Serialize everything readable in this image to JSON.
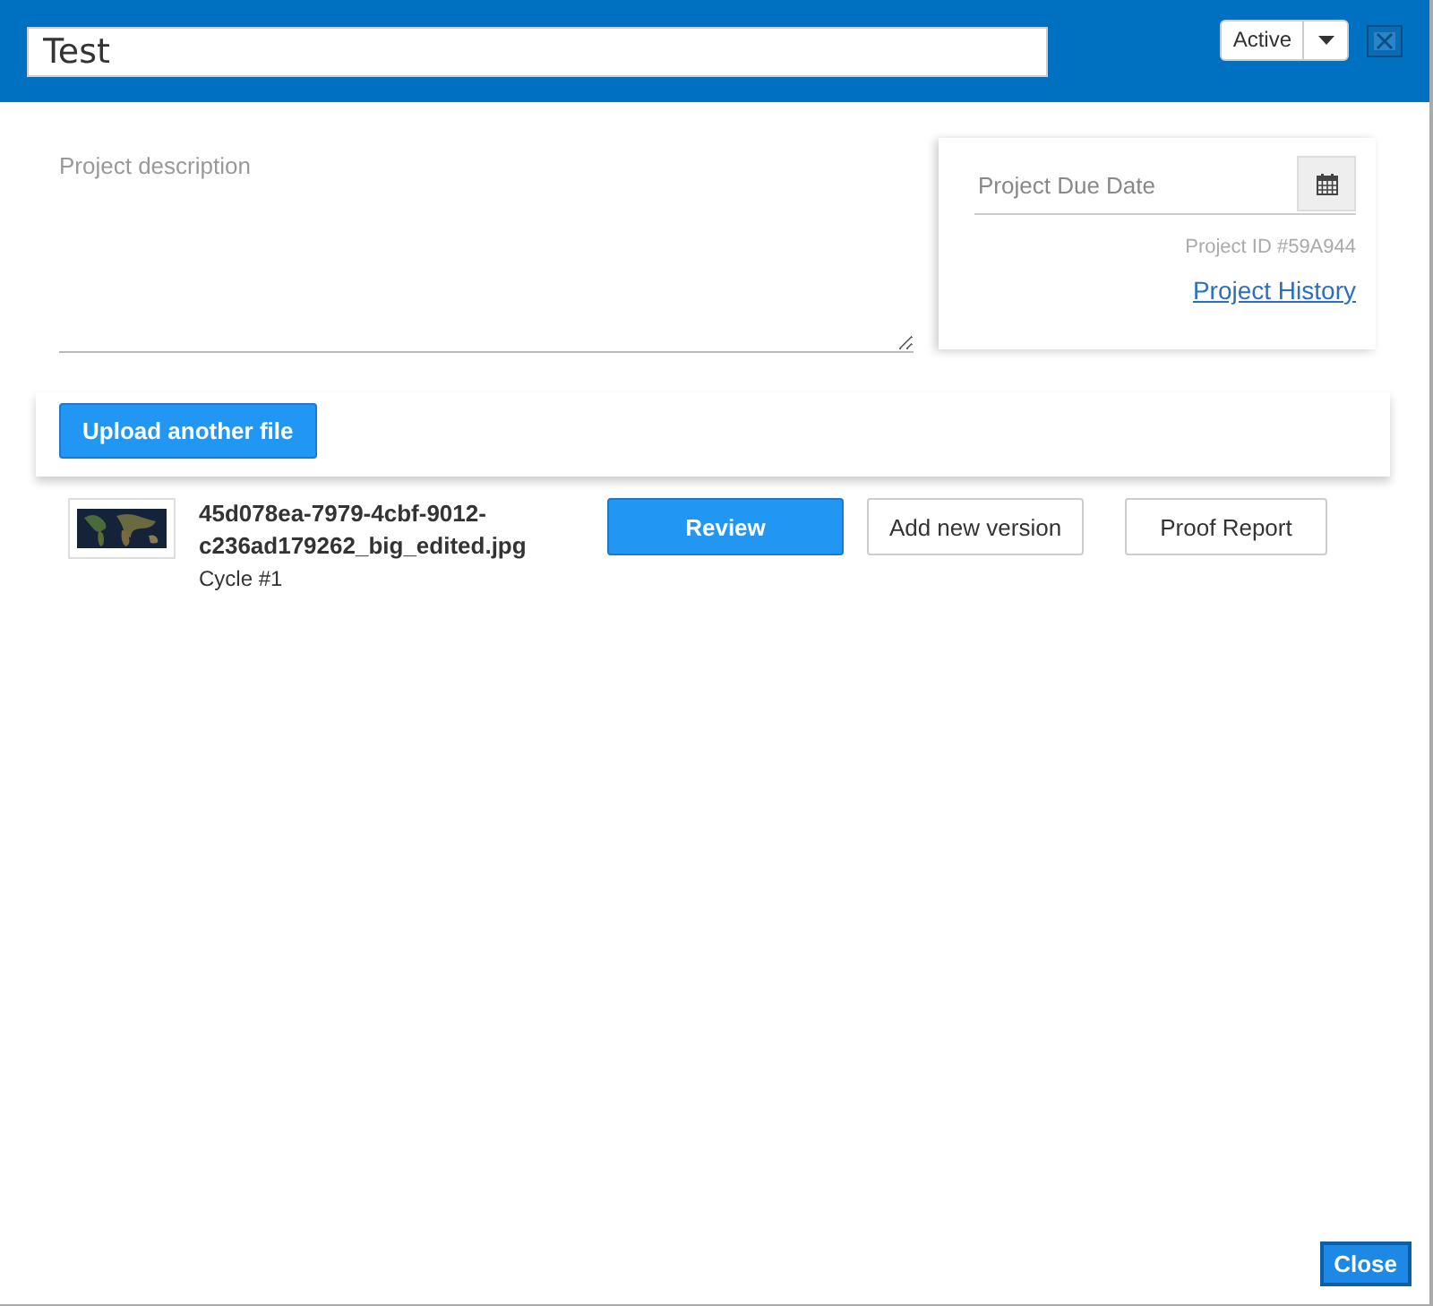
{
  "header": {
    "title": "Test",
    "status": "Active"
  },
  "description": {
    "placeholder": "Project description"
  },
  "details": {
    "due_date_placeholder": "Project Due Date",
    "project_id": "Project ID #59A944",
    "history_link": "Project History"
  },
  "upload_button": "Upload another file",
  "files": [
    {
      "name": "45d078ea-7979-4cbf-9012-c236ad179262_big_edited.jpg",
      "cycle": "Cycle #1",
      "actions": [
        "Review",
        "Add new version",
        "Proof Report"
      ]
    }
  ],
  "footer_button": "Close"
}
